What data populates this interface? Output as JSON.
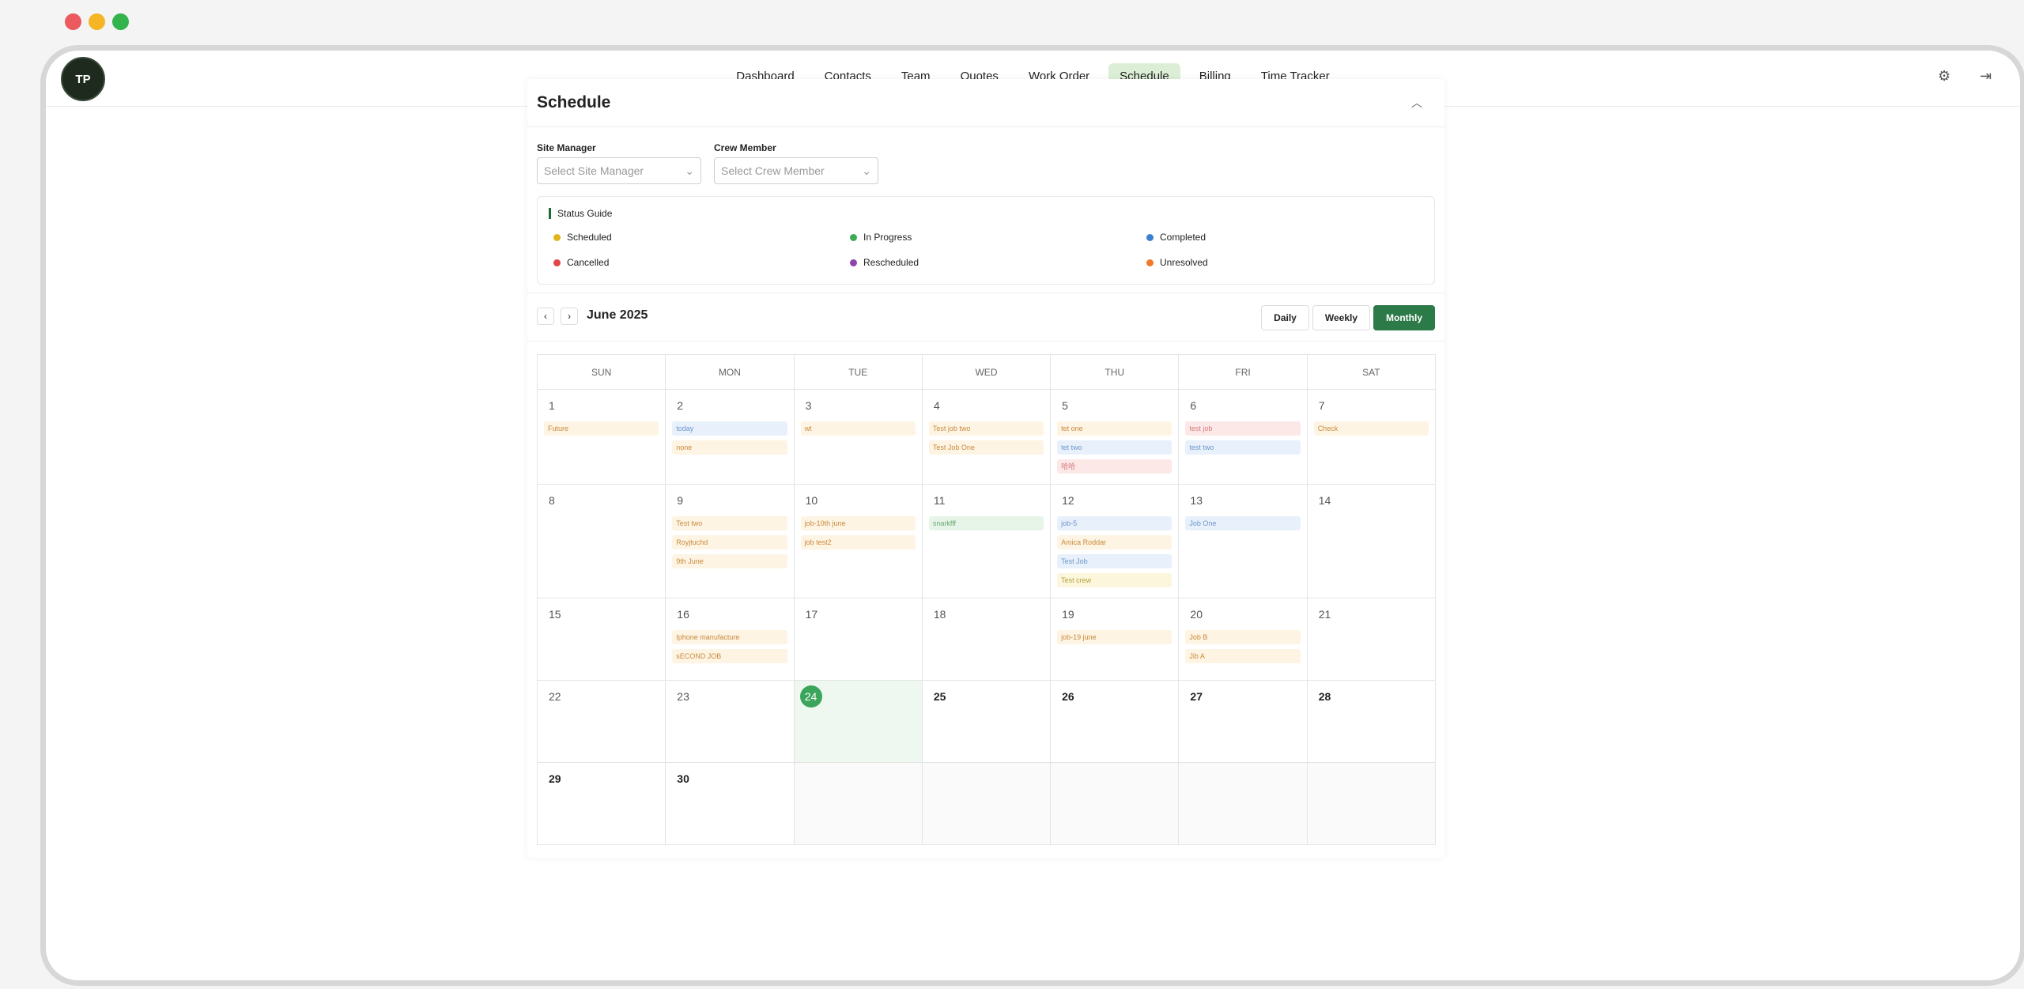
{
  "colors": {
    "accent": "#2c7a48",
    "active_nav_bg": "#dcefd6",
    "today": "#3ca55c",
    "window_red": "#ec5a5f",
    "window_yellow": "#f5b524",
    "window_green": "#32b34c"
  },
  "window": {
    "controls": [
      "close",
      "minimize",
      "maximize"
    ]
  },
  "brand": {
    "logo_text": "TP",
    "icon": "logo-icon"
  },
  "nav": {
    "items": [
      {
        "label": "Dashboard"
      },
      {
        "label": "Contacts"
      },
      {
        "label": "Team"
      },
      {
        "label": "Quotes"
      },
      {
        "label": "Work Order"
      },
      {
        "label": "Schedule",
        "active": true
      },
      {
        "label": "Billing"
      },
      {
        "label": "Time Tracker"
      }
    ],
    "right_icons": [
      "gear-icon",
      "logout-icon"
    ]
  },
  "page": {
    "title": "Schedule"
  },
  "filters": {
    "site_manager_label": "Site Manager",
    "site_manager_placeholder": "Select Site Manager",
    "crew_member_label": "Crew Member",
    "crew_member_placeholder": "Select Crew Member"
  },
  "status_guide": {
    "title": "Status Guide",
    "items": [
      {
        "label": "Scheduled",
        "color": "#e3b31c"
      },
      {
        "label": "In Progress",
        "color": "#3bab55"
      },
      {
        "label": "Completed",
        "color": "#3b7fd0"
      },
      {
        "label": "Cancelled",
        "color": "#e04848"
      },
      {
        "label": "Rescheduled",
        "color": "#8e44ad"
      },
      {
        "label": "Unresolved",
        "color": "#f07a2a"
      }
    ]
  },
  "calendar": {
    "month_label": "June 2025",
    "views": [
      {
        "label": "Daily"
      },
      {
        "label": "Weekly"
      },
      {
        "label": "Monthly",
        "active": true
      }
    ],
    "weekdays": [
      "SUN",
      "MON",
      "TUE",
      "WED",
      "THU",
      "FRI",
      "SAT"
    ],
    "today": "24",
    "weeks": [
      [
        {
          "day": "1",
          "events": [
            {
              "label": "Future",
              "status": "scheduled"
            }
          ]
        },
        {
          "day": "2",
          "events": [
            {
              "label": "today",
              "status": "completed"
            },
            {
              "label": "none",
              "status": "scheduled"
            }
          ]
        },
        {
          "day": "3",
          "events": [
            {
              "label": "wt",
              "status": "scheduled"
            }
          ]
        },
        {
          "day": "4",
          "events": [
            {
              "label": "Test job two",
              "status": "scheduled"
            },
            {
              "label": "Test Job One",
              "status": "scheduled"
            }
          ]
        },
        {
          "day": "5",
          "events": [
            {
              "label": "tet one",
              "status": "scheduled"
            },
            {
              "label": "tet two",
              "status": "completed"
            },
            {
              "label": "哈哈",
              "status": "cancelled"
            }
          ]
        },
        {
          "day": "6",
          "events": [
            {
              "label": "test job",
              "status": "cancelled"
            },
            {
              "label": "test two",
              "status": "completed"
            }
          ]
        },
        {
          "day": "7",
          "events": [
            {
              "label": "Check",
              "status": "scheduled"
            }
          ]
        }
      ],
      [
        {
          "day": "8",
          "events": []
        },
        {
          "day": "9",
          "events": [
            {
              "label": "Test two",
              "status": "scheduled"
            },
            {
              "label": "Royjtuchd",
              "status": "scheduled"
            },
            {
              "label": "9th June",
              "status": "scheduled"
            }
          ]
        },
        {
          "day": "10",
          "events": [
            {
              "label": "job-10th june",
              "status": "scheduled"
            },
            {
              "label": "job test2",
              "status": "scheduled"
            }
          ]
        },
        {
          "day": "11",
          "events": [
            {
              "label": "snarkfff",
              "status": "in_progress"
            }
          ]
        },
        {
          "day": "12",
          "events": [
            {
              "label": "job-5",
              "status": "completed"
            },
            {
              "label": "Amica Roddar",
              "status": "scheduled"
            },
            {
              "label": "Test Job",
              "status": "completed"
            },
            {
              "label": "Test crew",
              "status": "scheduled_yellow"
            }
          ]
        },
        {
          "day": "13",
          "events": [
            {
              "label": "Job One",
              "status": "completed"
            }
          ]
        },
        {
          "day": "14",
          "events": []
        }
      ],
      [
        {
          "day": "15",
          "events": []
        },
        {
          "day": "16",
          "events": [
            {
              "label": "Iphone manufacture",
              "status": "scheduled"
            },
            {
              "label": "sECOND JOB",
              "status": "scheduled"
            }
          ]
        },
        {
          "day": "17",
          "events": []
        },
        {
          "day": "18",
          "events": []
        },
        {
          "day": "19",
          "events": [
            {
              "label": "job-19 june",
              "status": "scheduled"
            }
          ]
        },
        {
          "day": "20",
          "events": [
            {
              "label": "Job B",
              "status": "scheduled"
            },
            {
              "label": "Jib A",
              "status": "scheduled"
            }
          ]
        },
        {
          "day": "21",
          "events": []
        }
      ],
      [
        {
          "day": "22",
          "events": []
        },
        {
          "day": "23",
          "events": []
        },
        {
          "day": "24",
          "events": [],
          "today": true
        },
        {
          "day": "25",
          "events": [],
          "future": true
        },
        {
          "day": "26",
          "events": [],
          "future": true
        },
        {
          "day": "27",
          "events": [],
          "future": true
        },
        {
          "day": "28",
          "events": [],
          "future": true
        }
      ],
      [
        {
          "day": "29",
          "events": [],
          "future": true
        },
        {
          "day": "30",
          "events": [],
          "future": true
        },
        {
          "day": "",
          "events": [],
          "empty": true
        },
        {
          "day": "",
          "events": [],
          "empty": true
        },
        {
          "day": "",
          "events": [],
          "empty": true
        },
        {
          "day": "",
          "events": [],
          "empty": true
        },
        {
          "day": "",
          "events": [],
          "empty": true
        }
      ]
    ]
  }
}
